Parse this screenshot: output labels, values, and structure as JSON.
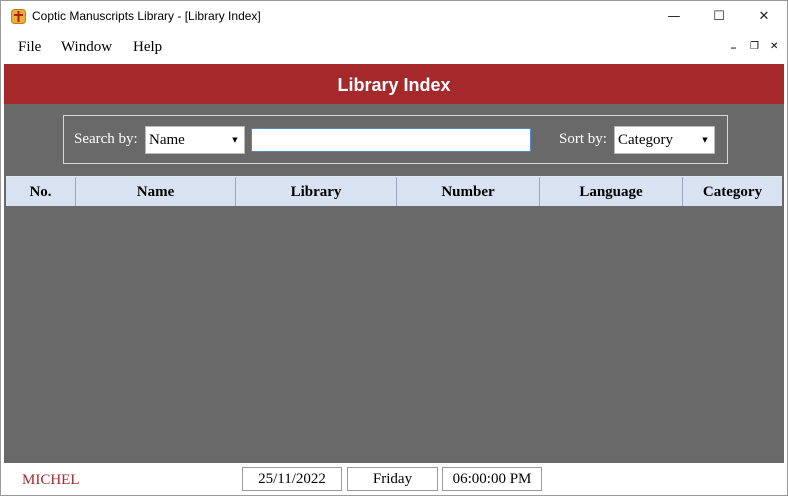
{
  "window": {
    "title": "Coptic Manuscripts Library - [Library Index]",
    "minimize_symbol": "—",
    "maximize_symbol": "☐",
    "close_symbol": "✕"
  },
  "menu": {
    "items": [
      "File",
      "Window",
      "Help"
    ],
    "mdi_minimize": "_",
    "mdi_restore": "❐",
    "mdi_close": "✕"
  },
  "header": {
    "title": "Library Index"
  },
  "search": {
    "search_by_label": "Search by:",
    "search_by_value": "Name",
    "search_text": "",
    "sort_by_label": "Sort by:",
    "sort_by_value": "Category"
  },
  "table": {
    "columns": [
      "No.",
      "Name",
      "Library",
      "Number",
      "Language",
      "Category"
    ],
    "rows": []
  },
  "status": {
    "user": "MICHEL",
    "date": "25/11/2022",
    "day": "Friday",
    "time": "06:00:00 PM"
  },
  "colors": {
    "header_red": "#a5282b",
    "body_gray": "#696969",
    "column_header_bg": "#d8e2f0",
    "user_text": "#a5282b"
  },
  "icons": {
    "app_icon": "app-logo-icon",
    "dropdown": "chevron-down-icon"
  }
}
